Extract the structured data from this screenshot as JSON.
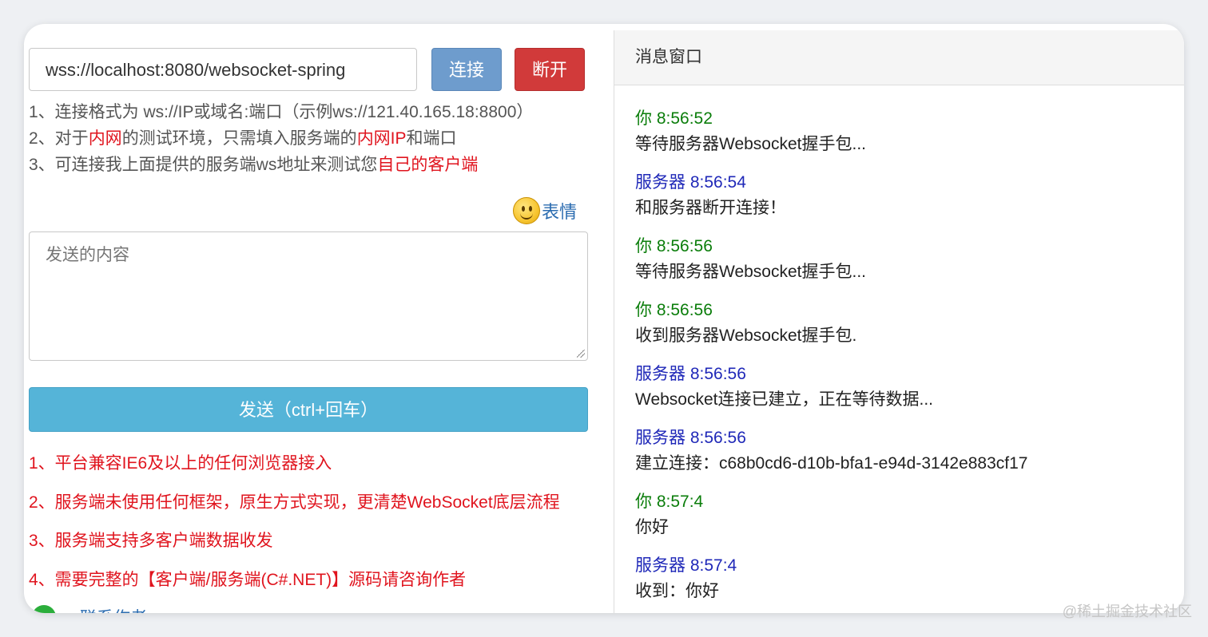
{
  "connection": {
    "url_value": "wss://localhost:8080/websocket-spring",
    "connect_label": "连接",
    "disconnect_label": "断开"
  },
  "tips": [
    {
      "parts": [
        {
          "text": "1、连接格式为 ws://IP或域名:端口（示例ws://121.40.165.18:8800）",
          "hl": false
        }
      ]
    },
    {
      "parts": [
        {
          "text": "2、对于",
          "hl": false
        },
        {
          "text": "内网",
          "hl": true
        },
        {
          "text": "的测试环境，只需填入服务端的",
          "hl": false
        },
        {
          "text": "内网IP",
          "hl": true
        },
        {
          "text": "和端口",
          "hl": false
        }
      ]
    },
    {
      "parts": [
        {
          "text": "3、可连接我上面提供的服务端ws地址来测试您",
          "hl": false
        },
        {
          "text": "自己的客户端",
          "hl": true
        }
      ]
    }
  ],
  "emoji": {
    "label": "表情",
    "icon": "smiley-icon"
  },
  "composer": {
    "placeholder": "发送的内容",
    "send_label": "发送（ctrl+回车）"
  },
  "features": [
    "1、平台兼容IE6及以上的任何浏览器接入",
    "2、服务端未使用任何框架，原生方式实现，更清楚WebSocket底层流程",
    "3、服务端支持多客户端数据收发",
    "4、需要完整的【客户端/服务端(C#.NET)】源码请咨询作者"
  ],
  "contact": {
    "label": "联系作者"
  },
  "messages_panel": {
    "title": "消息窗口",
    "messages": [
      {
        "sender": "你",
        "time": "8:56:52",
        "role": "you",
        "text": "等待服务器Websocket握手包..."
      },
      {
        "sender": "服务器",
        "time": "8:56:54",
        "role": "server",
        "text": "和服务器断开连接！"
      },
      {
        "sender": "你",
        "time": "8:56:56",
        "role": "you",
        "text": "等待服务器Websocket握手包..."
      },
      {
        "sender": "你",
        "time": "8:56:56",
        "role": "you",
        "text": "收到服务器Websocket握手包."
      },
      {
        "sender": "服务器",
        "time": "8:56:56",
        "role": "server",
        "text": "Websocket连接已建立，正在等待数据..."
      },
      {
        "sender": "服务器",
        "time": "8:56:56",
        "role": "server",
        "text": "建立连接：c68b0cd6-d10b-bfa1-e94d-3142e883cf17"
      },
      {
        "sender": "你",
        "time": "8:57:4",
        "role": "you",
        "text": "你好"
      },
      {
        "sender": "服务器",
        "time": "8:57:4",
        "role": "server",
        "text": "收到：你好"
      }
    ]
  },
  "colors": {
    "you": "#0a7d0a",
    "server": "#1f28b8",
    "highlight": "#e0141e",
    "send": "#55b4d8",
    "connect": "#6e9ccd",
    "disconnect": "#d13a3a"
  },
  "watermark": "@稀土掘金技术社区"
}
